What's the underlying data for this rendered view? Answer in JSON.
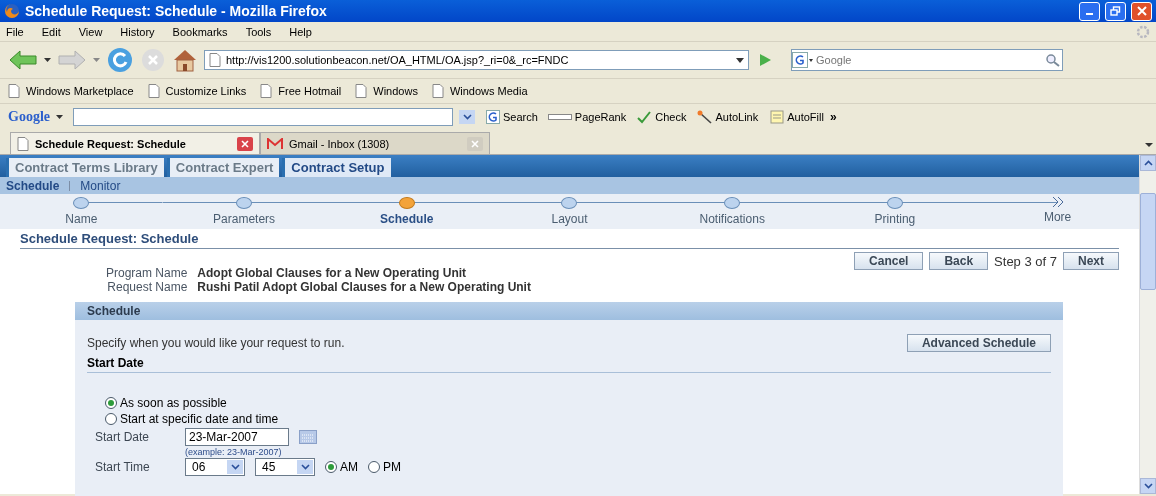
{
  "window": {
    "title": "Schedule Request: Schedule - Mozilla Firefox"
  },
  "menu": [
    "File",
    "Edit",
    "View",
    "History",
    "Bookmarks",
    "Tools",
    "Help"
  ],
  "navbar": {
    "url": "http://vis1200.solutionbeacon.net/OA_HTML/OA.jsp?_ri=0&_rc=FNDC",
    "search_placeholder": "Google"
  },
  "bookmarks": [
    "Windows Marketplace",
    "Customize Links",
    "Free Hotmail",
    "Windows",
    "Windows Media"
  ],
  "google_toolbar": {
    "logo": "Google",
    "items": [
      {
        "label": "Search",
        "kind": "search"
      },
      {
        "label": "PageRank",
        "kind": "pagerank"
      },
      {
        "label": "Check",
        "kind": "check"
      },
      {
        "label": "AutoLink",
        "kind": "autolink"
      },
      {
        "label": "AutoFill",
        "kind": "autofill"
      }
    ],
    "more": "»"
  },
  "browser_tabs": [
    {
      "label": "Schedule Request: Schedule",
      "selected": true
    },
    {
      "label": "Gmail - Inbox (1308)",
      "selected": false
    }
  ],
  "app_tabs": [
    {
      "label": "Contract Terms Library",
      "selected": false
    },
    {
      "label": "Contract Expert",
      "selected": false
    },
    {
      "label": "Contract Setup",
      "selected": true
    }
  ],
  "subnav": [
    {
      "label": "Schedule",
      "selected": true
    },
    {
      "label": "Monitor",
      "selected": false
    }
  ],
  "train": [
    {
      "label": "Name",
      "kind": "step",
      "selected": false
    },
    {
      "label": "Parameters",
      "kind": "step",
      "selected": false
    },
    {
      "label": "Schedule",
      "kind": "step",
      "selected": true
    },
    {
      "label": "Layout",
      "kind": "step",
      "selected": false
    },
    {
      "label": "Notifications",
      "kind": "step",
      "selected": false
    },
    {
      "label": "Printing",
      "kind": "step",
      "selected": false
    },
    {
      "label": "More",
      "kind": "more",
      "selected": false
    }
  ],
  "page_title": "Schedule Request: Schedule",
  "actions": {
    "cancel": "Cancel",
    "back": "Back",
    "step": "Step 3 of 7",
    "next": "Next"
  },
  "info": [
    {
      "label": "Program Name",
      "value": "Adopt Global Clauses for a New Operating Unit"
    },
    {
      "label": "Request Name",
      "value": "Rushi Patil Adopt Global Clauses for a New Operating Unit"
    }
  ],
  "section": {
    "title": "Schedule",
    "description": "Specify when you would like your request to run.",
    "advanced_button": "Advanced Schedule",
    "subheader": "Start Date",
    "options": [
      {
        "label": "As soon as possible",
        "selected": true
      },
      {
        "label": "Start at specific date and time",
        "selected": false
      }
    ],
    "start_date": {
      "label": "Start Date",
      "value": "23-Mar-2007",
      "hint": "(example: 23-Mar-2007)"
    },
    "start_time": {
      "label": "Start Time",
      "hour": "06",
      "minute": "45",
      "periods": [
        {
          "label": "AM",
          "selected": true
        },
        {
          "label": "PM",
          "selected": false
        }
      ]
    }
  }
}
